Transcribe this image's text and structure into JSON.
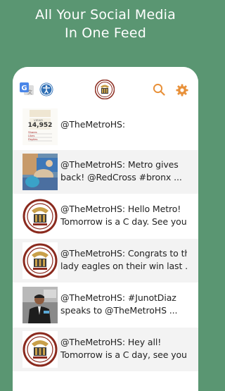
{
  "promo": {
    "line1": "All Your Social Media",
    "line2": "In One Feed"
  },
  "toolbar": {
    "icons": [
      "google-translate-icon",
      "accessibility-icon",
      "school-logo",
      "search-icon",
      "settings-icon"
    ],
    "accent_color": "#e8913a"
  },
  "feed": {
    "items": [
      {
        "line1": "@TheMetroHS:",
        "line2": "",
        "thumb": "stats-image"
      },
      {
        "line1": "@TheMetroHS: Metro gives",
        "line2": "back! @RedCross #bronx ...",
        "thumb": "photo-image"
      },
      {
        "line1": "@TheMetroHS: Hello Metro!",
        "line2": "Tomorrow is a C day. See you ...",
        "thumb": "school-logo"
      },
      {
        "line1": "@TheMetroHS: Congrats to the",
        "line2": "lady eagles on their win last ...",
        "thumb": "school-logo"
      },
      {
        "line1": "@TheMetroHS: #JunotDiaz",
        "line2": "speaks to @TheMetroHS ...",
        "thumb": "person-photo"
      },
      {
        "line1": "@TheMetroHS: Hey all!",
        "line2": "Tomorrow is a C day, see you ...",
        "thumb": "school-logo"
      }
    ]
  },
  "thumb_stats": {
    "label_top": "VIEWS",
    "number": "14,952",
    "rows": [
      "Shares",
      "Likes",
      "Replies"
    ]
  },
  "colors": {
    "background": "#5a9672",
    "logo_ring": "#8b2a1e",
    "logo_gold": "#c9a04a"
  }
}
